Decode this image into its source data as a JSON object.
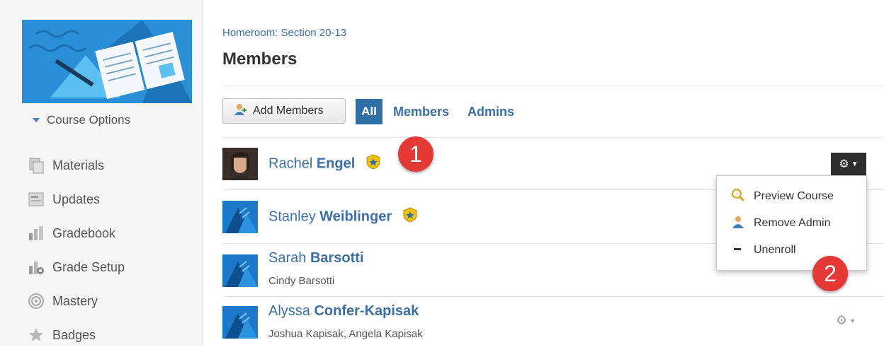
{
  "sidebar": {
    "course_options": "Course Options",
    "items": [
      {
        "label": "Materials",
        "icon": "materials-icon"
      },
      {
        "label": "Updates",
        "icon": "updates-icon"
      },
      {
        "label": "Gradebook",
        "icon": "gradebook-icon"
      },
      {
        "label": "Grade Setup",
        "icon": "grade-setup-icon"
      },
      {
        "label": "Mastery",
        "icon": "mastery-icon"
      },
      {
        "label": "Badges",
        "icon": "badges-icon"
      }
    ]
  },
  "header": {
    "breadcrumb": "Homeroom: Section 20-13",
    "title": "Members"
  },
  "toolbar": {
    "add_members": "Add Members",
    "tabs": [
      "All",
      "Members",
      "Admins"
    ]
  },
  "members": [
    {
      "first": "Rachel",
      "last": "Engel",
      "admin": true,
      "sub": ""
    },
    {
      "first": "Stanley",
      "last": "Weiblinger",
      "admin": true,
      "sub": ""
    },
    {
      "first": "Sarah",
      "last": "Barsotti",
      "admin": false,
      "sub": "Cindy Barsotti"
    },
    {
      "first": "Alyssa",
      "last": "Confer-Kapisak",
      "admin": false,
      "sub": "Joshua Kapisak, Angela Kapisak"
    }
  ],
  "dropdown": {
    "items": [
      {
        "label": "Preview Course",
        "icon": "magnifier-icon"
      },
      {
        "label": "Remove Admin",
        "icon": "user-icon"
      },
      {
        "label": "Unenroll",
        "icon": "minus-icon"
      }
    ]
  },
  "callouts": [
    "1",
    "2"
  ],
  "colors": {
    "link": "#3b6ea5",
    "accent": "#2f6fa8",
    "callout": "#e53935",
    "banner": "#2a8fd6"
  }
}
